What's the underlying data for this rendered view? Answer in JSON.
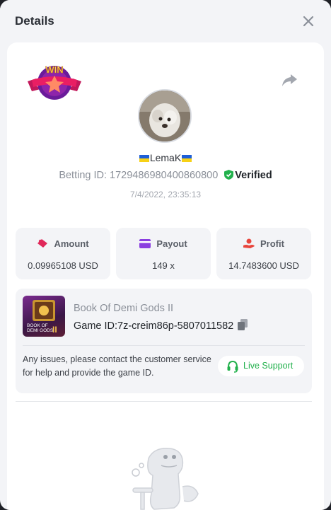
{
  "header": {
    "title": "Details"
  },
  "badge": {
    "text": "WIN"
  },
  "user": {
    "username": "LemaK"
  },
  "bet": {
    "betting_id_label": "Betting ID: 1729486980400860800",
    "verified_label": "Verified",
    "datetime": "7/4/2022, 23:35:13"
  },
  "stats": [
    {
      "label": "Amount",
      "value": "0.09965108 USD"
    },
    {
      "label": "Payout",
      "value": "149 x"
    },
    {
      "label": "Profit",
      "value": "14.7483600 USD"
    }
  ],
  "game": {
    "name": "Book Of Demi Gods II",
    "game_id_label": "Game ID:7z-creim86p-5807011582",
    "thumb_text_1": "BOOK OF",
    "thumb_text_2": "DEMI GODS",
    "thumb_text_3": "II"
  },
  "support": {
    "message": "Any issues, please contact the customer service for help and provide the game ID.",
    "button_label": "Live Support"
  },
  "colors": {
    "accent_green": "#22b14c",
    "amount_icon": "#e0285a",
    "payout_icon": "#8a3ee0",
    "profit_icon": "#e8453c"
  }
}
